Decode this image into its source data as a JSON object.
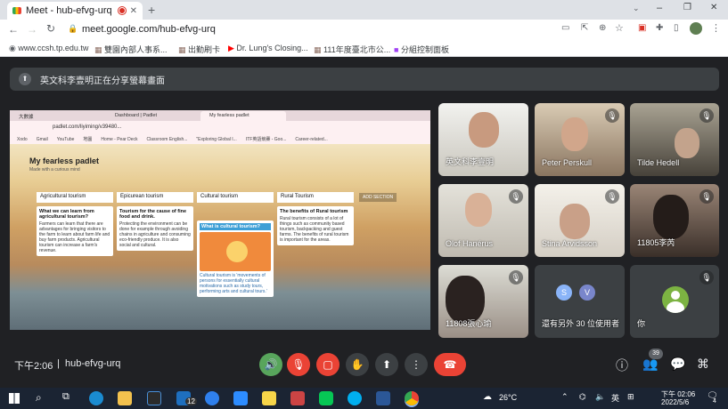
{
  "tab": {
    "title": "Meet - hub-efvg-urq"
  },
  "window": {
    "minimize": "–",
    "maximize": "❐",
    "close": "✕"
  },
  "address": {
    "url": "meet.google.com/hub-efvg-urq"
  },
  "bookmarks": [
    "www.ccsh.tp.edu.tw",
    "雙園內部人事系...",
    "出勤刷卡",
    "Dr. Lung's Closing...",
    "111年度臺北市公...",
    "分組控制面板"
  ],
  "meet": {
    "banner_text": "英文科李壹明正在分享螢幕畫面",
    "time": "下午2:06",
    "meeting_code": "hub-efvg-urq",
    "people_count": "39"
  },
  "participants": [
    {
      "name": "英文科李壹明"
    },
    {
      "name": "Peter Perskull"
    },
    {
      "name": "Tilde Hedell"
    },
    {
      "name": "Olof Hanérus"
    },
    {
      "name": "Stina Arvidsson"
    },
    {
      "name": "11805李芮"
    },
    {
      "name": "11808張心瑜"
    },
    {
      "name": "還有另外 30 位使用者"
    },
    {
      "name": "你"
    }
  ],
  "others_avatars": [
    "S",
    "V"
  ],
  "shared": {
    "tabs": [
      "大數據",
      "Dashboard | Padlet",
      "My fearless padlet"
    ],
    "url": "padlet.com/liyiming/v39480...",
    "bookmarks": [
      "Xodo",
      "Gmail",
      "YouTube",
      "地圖",
      "Home - Pear Deck",
      "Classroom English...",
      "\"Exploring Global I...",
      "ITF英語競賽 - Goo...",
      "Career-related..."
    ],
    "padlet_title": "My fearless padlet",
    "padlet_subtitle": "Made with a curious mind",
    "columns": [
      "Agricultural tourism",
      "Epicurean tourism",
      "Cultural tourism",
      "Rural Tourism"
    ],
    "add_section": "ADD SECTION",
    "cards": [
      {
        "title": "What we can learn from agricultural tourism?",
        "body": "Farmers can learn that there are advantages for bringing visitors to the farm to learn about farm life and buy farm products. Agricultural tourism can increase a farm's revenue."
      },
      {
        "title": "Tourism for the cause of fine food and drink.",
        "body": "Protecting the environment can be done for example through avoiding chains in agriculture and consuming eco-friendly produce. It is also social and cultural."
      },
      {
        "title": "What is cultural tourism?",
        "body": "Cultural tourism is 'movements of persons for essentially cultural motivations such as study tours, performing arts and cultural tours.'"
      },
      {
        "title": "The benefits of Rural tourism",
        "body": "Rural tourism consists of a lot of things such as community based tourism, backpacking and guest farms. The benefits of rural tourism is important for the areas."
      }
    ]
  },
  "taskbar": {
    "temperature": "26°C",
    "ime": "英",
    "time": "下午 02:06",
    "date": "2022/5/6",
    "badge": "12",
    "notif": "4"
  }
}
